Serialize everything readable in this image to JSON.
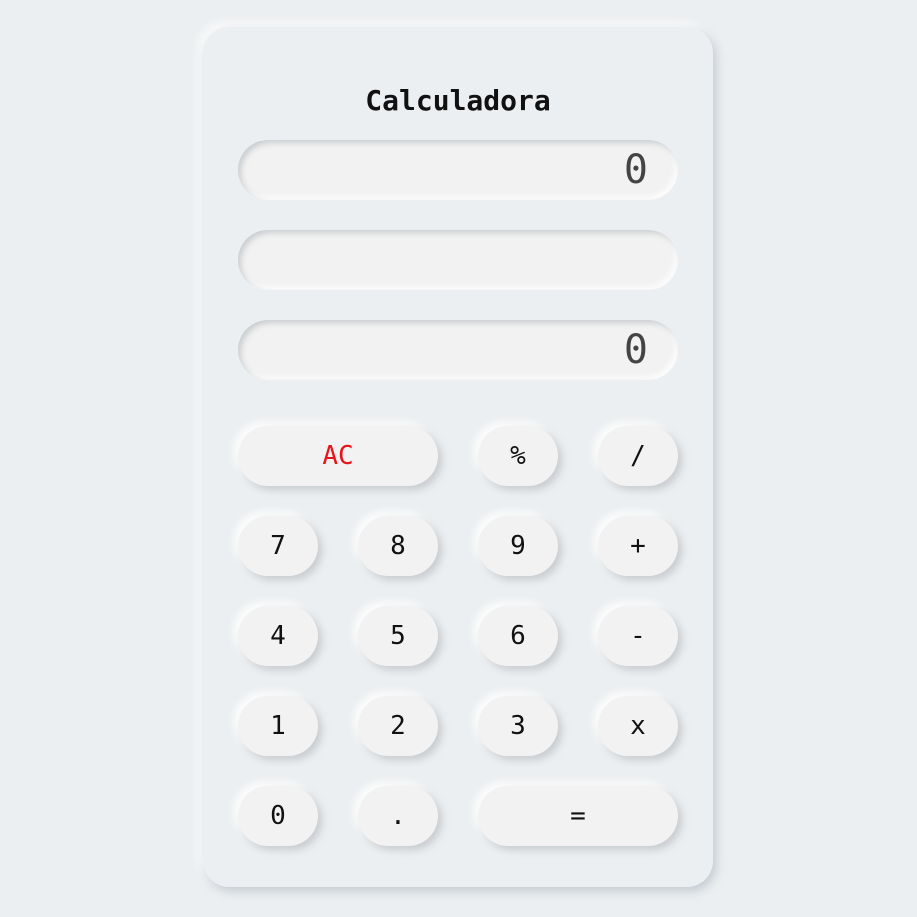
{
  "app": {
    "title": "Calculadora"
  },
  "displays": {
    "top_value": "0",
    "middle_value": "",
    "bottom_value": "0"
  },
  "colors": {
    "background": "#eceff1",
    "button_face": "#f2f2f2",
    "clear_accent": "#e8141b",
    "text": "#111111"
  },
  "keys": {
    "clear": "AC",
    "percent": "%",
    "divide": "/",
    "seven": "7",
    "eight": "8",
    "nine": "9",
    "plus": "+",
    "four": "4",
    "five": "5",
    "six": "6",
    "minus": "-",
    "one": "1",
    "two": "2",
    "three": "3",
    "multiply": "x",
    "zero": "0",
    "decimal": ".",
    "equals": "="
  }
}
